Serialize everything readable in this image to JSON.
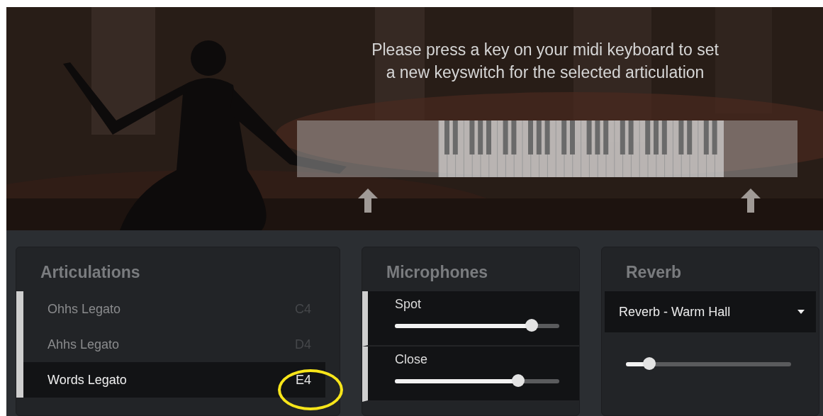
{
  "prompt": {
    "lines": [
      "Please press a key on your midi keyboard to set",
      "a new keyswitch for the selected articulation"
    ]
  },
  "articulations": {
    "title": "Articulations",
    "items": [
      {
        "label": "Ohhs Legato",
        "key": "C4",
        "selected": false
      },
      {
        "label": "Ahhs Legato",
        "key": "D4",
        "selected": false
      },
      {
        "label": "Words Legato",
        "key": "E4",
        "selected": true
      }
    ]
  },
  "microphones": {
    "title": "Microphones",
    "channels": [
      {
        "name": "Spot",
        "level": 0.83
      },
      {
        "name": "Close",
        "level": 0.75
      }
    ]
  },
  "reverb": {
    "title": "Reverb",
    "preset": "Reverb - Warm Hall",
    "level": 0.14
  }
}
